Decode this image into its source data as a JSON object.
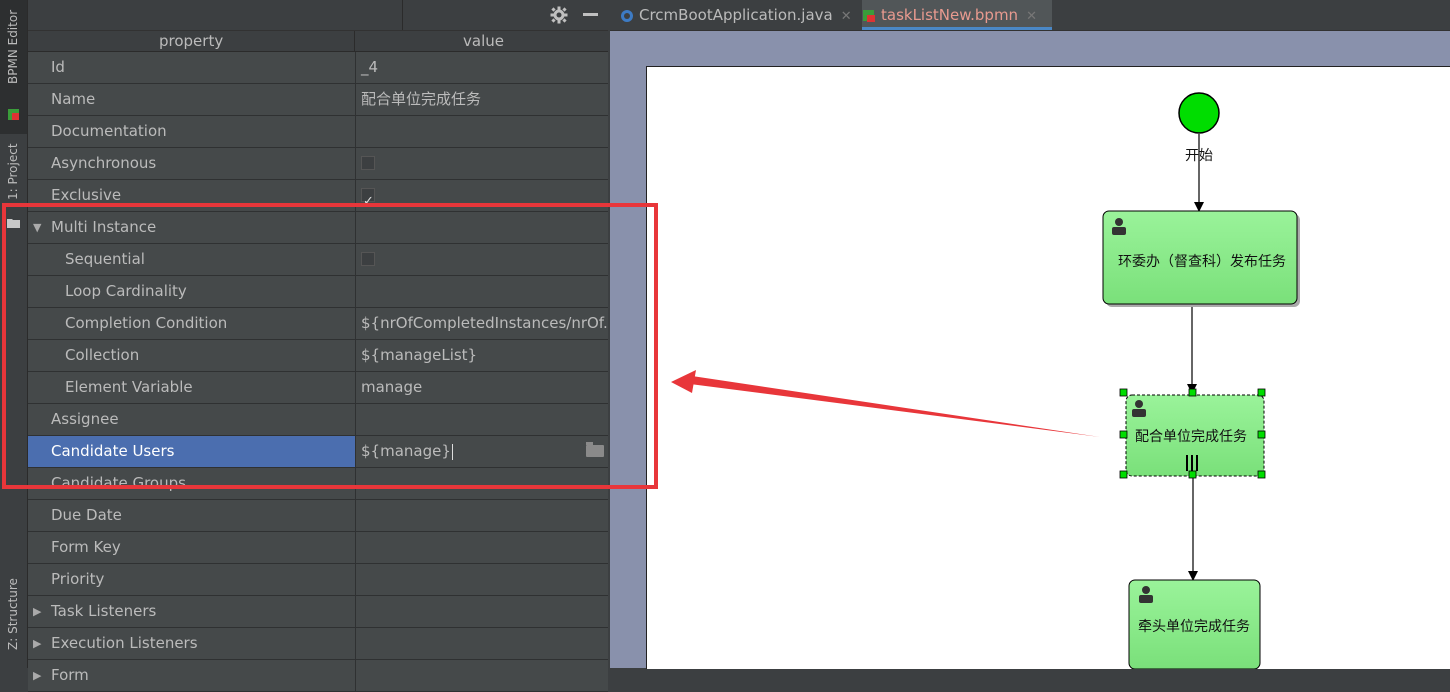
{
  "side_stripe": {
    "bpmn_editor_label": "BPMN Editor",
    "project_label": "1: Project",
    "structure_label": "Z: Structure"
  },
  "properties": {
    "header": {
      "property": "property",
      "value": "value"
    },
    "rows": [
      {
        "label": "Id",
        "value": "_4",
        "kind": "text"
      },
      {
        "label": "Name",
        "value": "配合单位完成任务",
        "kind": "text"
      },
      {
        "label": "Documentation",
        "value": "",
        "kind": "text"
      },
      {
        "label": "Asynchronous",
        "value": "",
        "kind": "checkbox",
        "checked": false
      },
      {
        "label": "Exclusive",
        "value": "",
        "kind": "checkbox",
        "checked": true
      },
      {
        "label": "Multi Instance",
        "value": "",
        "kind": "group",
        "expanded": true
      },
      {
        "label": "Sequential",
        "value": "",
        "kind": "checkbox",
        "checked": false
      },
      {
        "label": "Loop Cardinality",
        "value": "",
        "kind": "text"
      },
      {
        "label": "Completion Condition",
        "value": "${nrOfCompletedInstances/nrOf...",
        "kind": "text"
      },
      {
        "label": "Collection",
        "value": "${manageList}",
        "kind": "text"
      },
      {
        "label": "Element Variable",
        "value": "manage",
        "kind": "text"
      },
      {
        "label": "Assignee",
        "value": "",
        "kind": "text"
      },
      {
        "label": "Candidate Users",
        "value": "${manage}",
        "kind": "text",
        "selected": true
      },
      {
        "label": "Candidate Groups",
        "value": "",
        "kind": "text"
      },
      {
        "label": "Due Date",
        "value": "",
        "kind": "text"
      },
      {
        "label": "Form Key",
        "value": "",
        "kind": "text"
      },
      {
        "label": "Priority",
        "value": "",
        "kind": "text"
      },
      {
        "label": "Task Listeners",
        "value": "",
        "kind": "group",
        "expanded": false
      },
      {
        "label": "Execution Listeners",
        "value": "",
        "kind": "group",
        "expanded": false
      },
      {
        "label": "Form",
        "value": "",
        "kind": "group",
        "expanded": false
      }
    ]
  },
  "tabs": [
    {
      "label": "CrcmBootApplication.java",
      "active": false
    },
    {
      "label": "taskListNew.bpmn",
      "active": true
    }
  ],
  "diagram": {
    "start_label": "开始",
    "task1_label": "环委办（督查科）发布任务",
    "task2_label": "配合单位完成任务",
    "task3_label": "牵头单位完成任务"
  },
  "colors": {
    "selection": "#4b6eaf",
    "annotation": "#e8363a",
    "task_fill": "#90ee90",
    "start_fill": "#00dd00"
  }
}
